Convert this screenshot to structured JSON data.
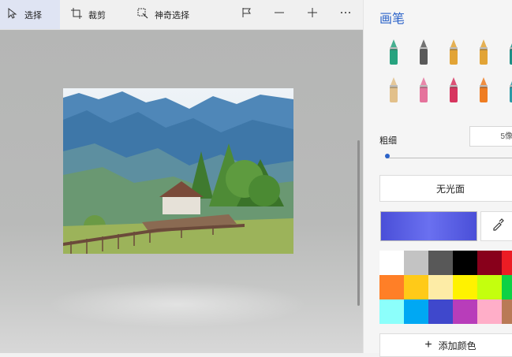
{
  "toolbar": {
    "select_label": "选择",
    "crop_label": "裁剪",
    "magic_select_label": "神奇选择"
  },
  "panel": {
    "title": "画笔",
    "thickness_label": "粗细",
    "thickness_value": "5像",
    "opacity_mode": "无光面",
    "add_color_label": "添加颜色"
  },
  "brushes": [
    {
      "name": "marker-icon",
      "color": "#27a37f"
    },
    {
      "name": "calligraphy-pen-icon",
      "color": "#5a5a5a"
    },
    {
      "name": "oil-brush-icon",
      "color": "#e2a436"
    },
    {
      "name": "watercolor-brush-icon",
      "color": "#e2a436"
    },
    {
      "name": "pixel-pen-icon",
      "color": "#1e8f86"
    },
    {
      "name": "pencil-icon",
      "color": "#e2c08a"
    },
    {
      "name": "eraser-icon",
      "color": "#e5739c"
    },
    {
      "name": "crayon-icon",
      "color": "#d7355f"
    },
    {
      "name": "spray-can-icon",
      "color": "#ef7d22"
    },
    {
      "name": "fill-icon",
      "color": "#2b9aa6"
    }
  ],
  "current_color": "#4a4fd8",
  "palette": [
    [
      "#ffffff",
      "#c3c3c3",
      "#585858",
      "#000000",
      "#88001b",
      "#ec1c24"
    ],
    [
      "#ff7f27",
      "#ffca18",
      "#fdeca6",
      "#fff200",
      "#c4ff0e",
      "#0ed145"
    ],
    [
      "#8cfffb",
      "#00a8f3",
      "#3f48cc",
      "#b83dba",
      "#ffaec8",
      "#b97a56"
    ]
  ]
}
